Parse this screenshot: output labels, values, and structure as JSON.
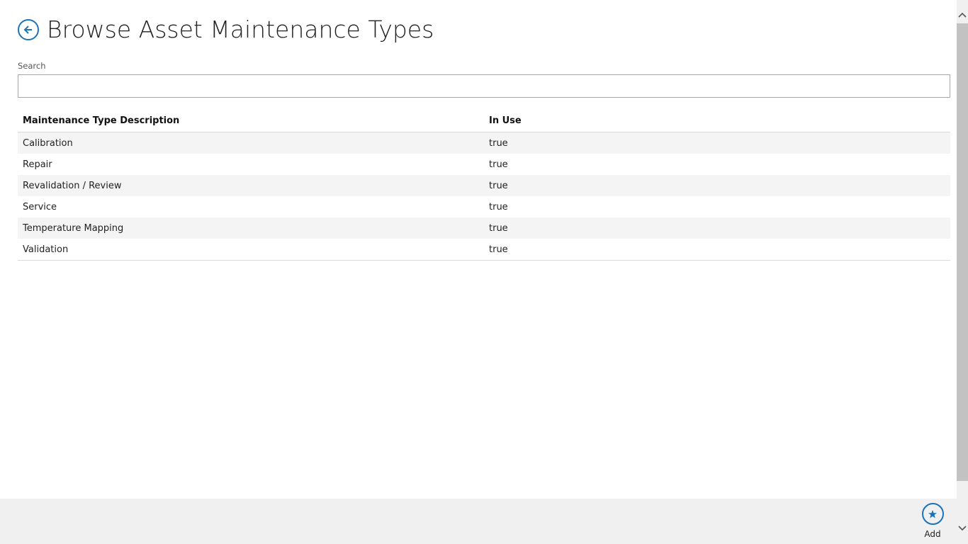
{
  "header": {
    "title": "Browse Asset Maintenance Types",
    "back_icon": "back-arrow-icon"
  },
  "search": {
    "label": "Search",
    "value": "",
    "placeholder": ""
  },
  "table": {
    "columns": [
      "Maintenance Type Description",
      "In Use"
    ],
    "rows": [
      {
        "description": "Calibration",
        "in_use": "true"
      },
      {
        "description": "Repair",
        "in_use": "true"
      },
      {
        "description": "Revalidation / Review",
        "in_use": "true"
      },
      {
        "description": "Service",
        "in_use": "true"
      },
      {
        "description": "Temperature Mapping",
        "in_use": "true"
      },
      {
        "description": "Validation",
        "in_use": "true"
      }
    ]
  },
  "appbar": {
    "add_label": "Add",
    "add_icon": "star-icon"
  },
  "colors": {
    "accent": "#1e73b8",
    "row_alt": "#f4f4f4",
    "appbar_bg": "#f0f0f0"
  }
}
